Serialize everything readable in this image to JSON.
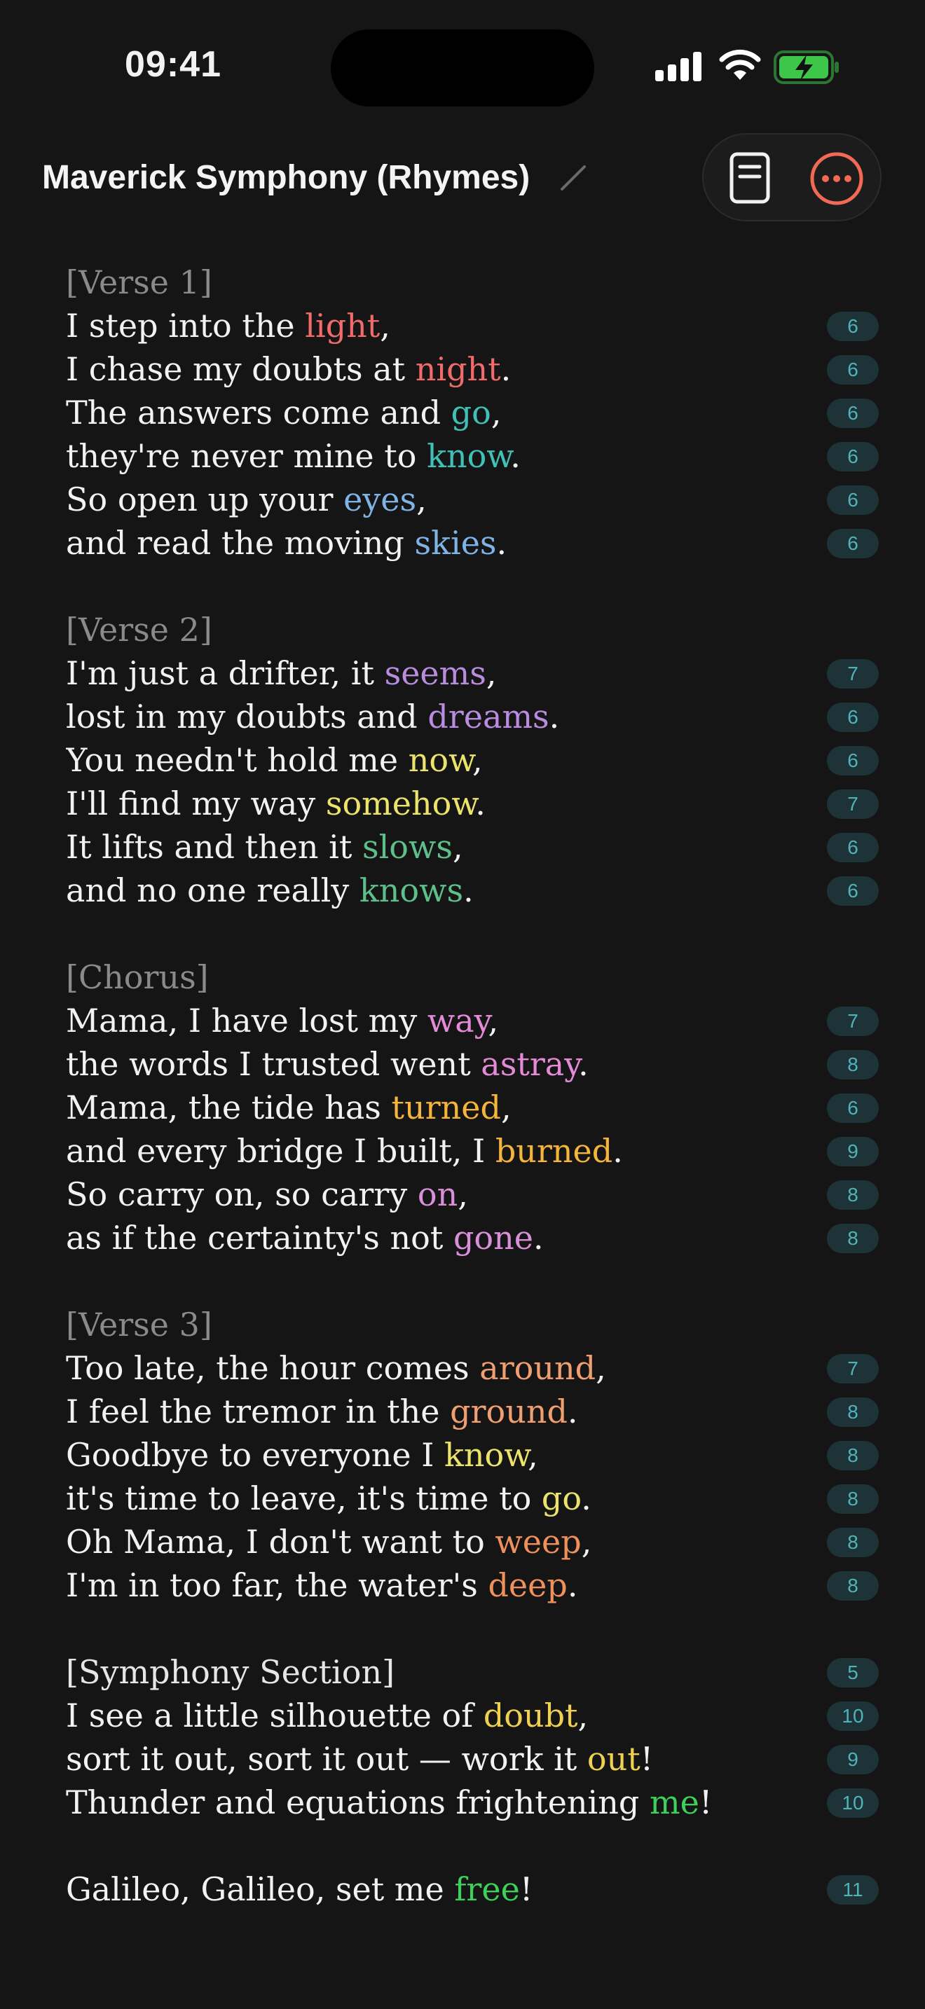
{
  "status": {
    "time": "09:41"
  },
  "header": {
    "title": "Maverick Symphony (Rhymes)"
  },
  "colors": {
    "background": "#151515",
    "accent": "#f06a55",
    "badge_bg": "#1d3338",
    "badge_text": "#4fb3b8",
    "battery": "#3ec64a"
  },
  "icons": {
    "edit": "pencil-icon",
    "document": "document-icon",
    "more": "more-icon"
  },
  "lyrics": [
    {
      "type": "header",
      "text": "[Verse 1]"
    },
    {
      "type": "line",
      "pre": "I step into the ",
      "rhyme": "light",
      "post": ",",
      "color": "#f26b6b",
      "count": "6"
    },
    {
      "type": "line",
      "pre": "I chase my doubts at ",
      "rhyme": "night",
      "post": ".",
      "color": "#f26b6b",
      "count": "6"
    },
    {
      "type": "line",
      "pre": "The answers come and ",
      "rhyme": "go",
      "post": ",",
      "color": "#3fc1b8",
      "count": "6"
    },
    {
      "type": "line",
      "pre": "they're never mine to ",
      "rhyme": "know",
      "post": ".",
      "color": "#3fc1b8",
      "count": "6"
    },
    {
      "type": "line",
      "pre": "So open up your ",
      "rhyme": "eyes",
      "post": ",",
      "color": "#7fb3e6",
      "count": "6"
    },
    {
      "type": "line",
      "pre": "and read the moving ",
      "rhyme": "skies",
      "post": ".",
      "color": "#7fb3e6",
      "count": "6"
    },
    {
      "type": "gap"
    },
    {
      "type": "header",
      "text": "[Verse 2]"
    },
    {
      "type": "line",
      "pre": "I'm just a drifter, it ",
      "rhyme": "seems",
      "post": ",",
      "color": "#b98ce0",
      "count": "7"
    },
    {
      "type": "line",
      "pre": "lost in my doubts and ",
      "rhyme": "dreams",
      "post": ".",
      "color": "#b98ce0",
      "count": "6"
    },
    {
      "type": "line",
      "pre": "You needn't hold me ",
      "rhyme": "now",
      "post": ",",
      "color": "#ece36a",
      "count": "6"
    },
    {
      "type": "line",
      "pre": "I'll find my way ",
      "rhyme": "somehow",
      "post": ".",
      "color": "#ece36a",
      "count": "7"
    },
    {
      "type": "line",
      "pre": "It lifts and then it ",
      "rhyme": "slows",
      "post": ",",
      "color": "#5fbf8a",
      "count": "6"
    },
    {
      "type": "line",
      "pre": "and no one really ",
      "rhyme": "knows",
      "post": ".",
      "color": "#5fbf8a",
      "count": "6"
    },
    {
      "type": "gap"
    },
    {
      "type": "header",
      "text": "[Chorus]"
    },
    {
      "type": "line",
      "pre": "Mama, I have lost my ",
      "rhyme": "way",
      "post": ",",
      "color": "#e48ad6",
      "count": "7"
    },
    {
      "type": "line",
      "pre": "the words I trusted went ",
      "rhyme": "astray",
      "post": ".",
      "color": "#e48ad6",
      "count": "8"
    },
    {
      "type": "line",
      "pre": "Mama, the tide has ",
      "rhyme": "turned",
      "post": ",",
      "color": "#f5b53a",
      "count": "6"
    },
    {
      "type": "line",
      "pre": "and every bridge I built, I ",
      "rhyme": "burned",
      "post": ".",
      "color": "#f5b53a",
      "count": "9"
    },
    {
      "type": "line",
      "pre": "So carry on, so carry ",
      "rhyme": "on",
      "post": ",",
      "color": "#d98fd9",
      "count": "8"
    },
    {
      "type": "line",
      "pre": "as if the certainty's not ",
      "rhyme": "gone",
      "post": ".",
      "color": "#d98fd9",
      "count": "8"
    },
    {
      "type": "gap"
    },
    {
      "type": "header",
      "text": "[Verse 3]"
    },
    {
      "type": "line",
      "pre": "Too late, the hour comes ",
      "rhyme": "around",
      "post": ",",
      "color": "#f0a070",
      "count": "7"
    },
    {
      "type": "line",
      "pre": "I feel the tremor in the ",
      "rhyme": "ground",
      "post": ".",
      "color": "#f0a070",
      "count": "8"
    },
    {
      "type": "line",
      "pre": "Goodbye to everyone I ",
      "rhyme": "know",
      "post": ",",
      "color": "#ece36a",
      "count": "8"
    },
    {
      "type": "line",
      "pre": "it's time to leave, it's time to ",
      "rhyme": "go",
      "post": ".",
      "color": "#ece36a",
      "count": "8"
    },
    {
      "type": "line",
      "pre": "Oh Mama, I don't want to ",
      "rhyme": "weep",
      "post": ",",
      "color": "#f0905a",
      "count": "8"
    },
    {
      "type": "line",
      "pre": "I'm in too far, the water's ",
      "rhyme": "deep",
      "post": ".",
      "color": "#f0905a",
      "count": "8"
    },
    {
      "type": "gap"
    },
    {
      "type": "header",
      "text": "[Symphony Section]",
      "bright": true,
      "count": "5"
    },
    {
      "type": "line",
      "pre": "I see a little silhouette of ",
      "rhyme": "doubt",
      "post": ",",
      "color": "#f0d050",
      "count": "10"
    },
    {
      "type": "line",
      "pre": "sort it out, sort it out — work it ",
      "rhyme": "out",
      "post": "!",
      "color": "#f0d050",
      "count": "9"
    },
    {
      "type": "line",
      "wrap": true,
      "pre": "Thunder and equations frightening ",
      "rhyme": "me",
      "post": "!",
      "color": "#3ed15a",
      "count": "10"
    },
    {
      "type": "line",
      "pre": "Galileo, Galileo, set me ",
      "rhyme": "free",
      "post": "!",
      "color": "#3ed15a",
      "count": "11"
    }
  ]
}
